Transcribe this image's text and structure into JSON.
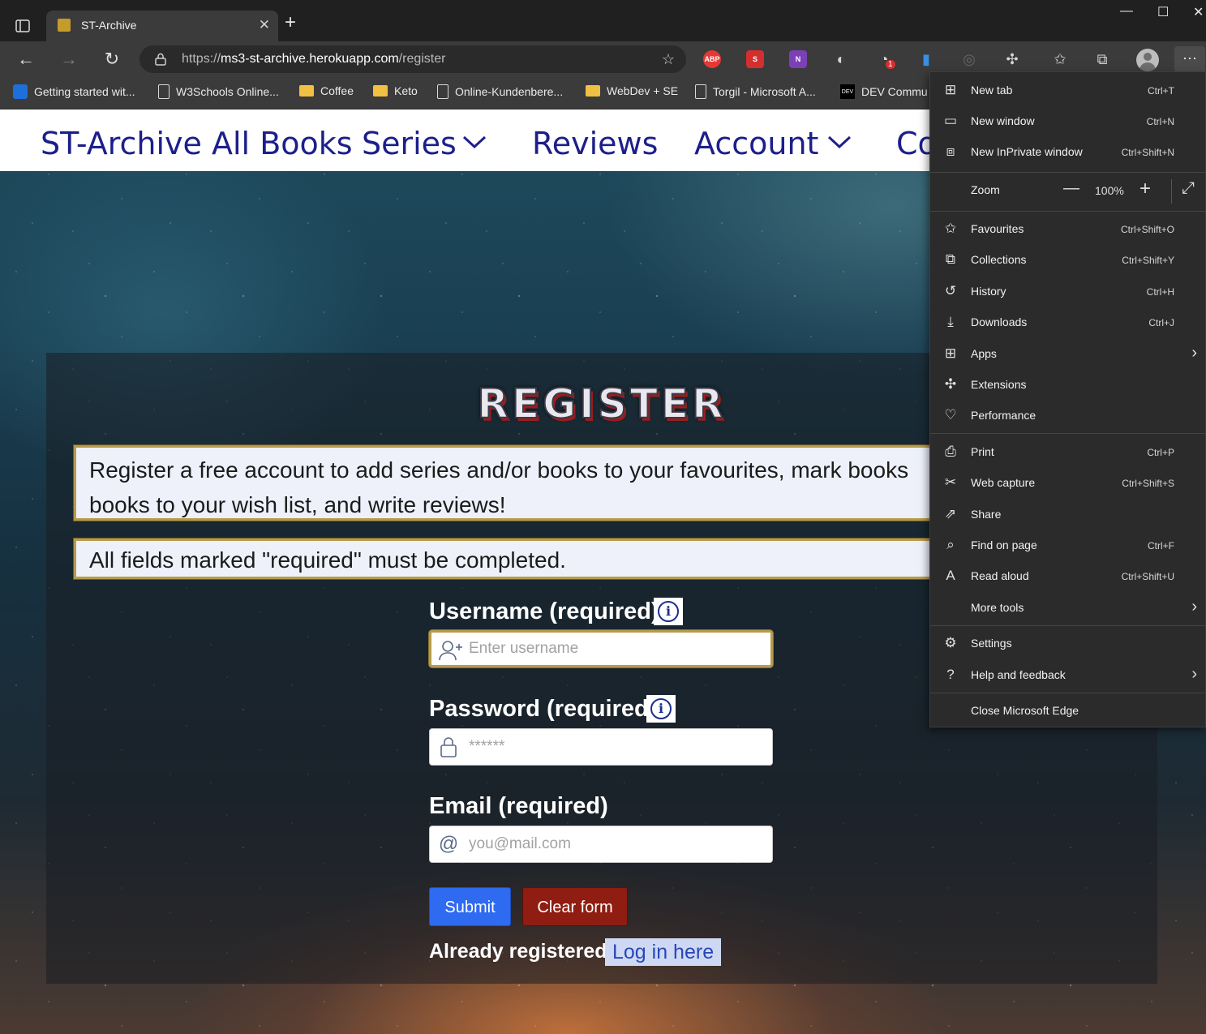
{
  "browser": {
    "tab_title": "ST-Archive",
    "url_prefix": "https://",
    "url_host": "ms3-st-archive.herokuapp.com",
    "url_path": "/register",
    "extensions": [
      "ABP",
      "S",
      "N"
    ],
    "profile_badge": "1",
    "favourites": [
      {
        "label": "Getting started wit...",
        "icon": "edge-icon"
      },
      {
        "label": "W3Schools Online...",
        "icon": "page-icon"
      },
      {
        "label": "Coffee",
        "icon": "folder-icon"
      },
      {
        "label": "Keto",
        "icon": "folder-icon"
      },
      {
        "label": "Online-Kundenbere...",
        "icon": "page-icon"
      },
      {
        "label": "WebDev + SE",
        "icon": "folder-icon"
      },
      {
        "label": "Torgil - Microsoft A...",
        "icon": "page-icon"
      },
      {
        "label": "DEV Commu",
        "icon": "dev-icon"
      }
    ]
  },
  "site": {
    "nav": {
      "brand": "ST-Archive",
      "all_books": "All Books",
      "series": "Series",
      "reviews": "Reviews",
      "account": "Account",
      "contact_partial": "Co"
    },
    "title": "REGISTER",
    "info_text": "Register a free account to add series and/or books to your favourites, mark books books to your wish list, and write reviews!",
    "info_line1": "Register a free account to add series and/or books to your favourites, mark books",
    "info_line2": "books to your wish list, and write reviews!",
    "required_note": "All fields marked \"required\" must be completed.",
    "form": {
      "username_label": "Username (required)",
      "username_placeholder": "Enter username",
      "password_label": "Password (required)",
      "password_placeholder": "******",
      "email_label": "Email (required)",
      "email_placeholder": "you@mail.com",
      "submit": "Submit",
      "clear": "Clear form",
      "already": "Already registered?",
      "login": "Log in here"
    },
    "colors": {
      "accent": "#2f6bf1",
      "danger": "#8f1d11",
      "nav_text": "#1c1f8a",
      "box_border": "#b79b4b"
    }
  },
  "menu": {
    "new_tab": {
      "label": "New tab",
      "shortcut": "Ctrl+T"
    },
    "new_window": {
      "label": "New window",
      "shortcut": "Ctrl+N"
    },
    "inprivate": {
      "label": "New InPrivate window",
      "shortcut": "Ctrl+Shift+N"
    },
    "zoom": {
      "label": "Zoom",
      "value": "100%"
    },
    "favourites": {
      "label": "Favourites",
      "shortcut": "Ctrl+Shift+O"
    },
    "collections": {
      "label": "Collections",
      "shortcut": "Ctrl+Shift+Y"
    },
    "history": {
      "label": "History",
      "shortcut": "Ctrl+H"
    },
    "downloads": {
      "label": "Downloads",
      "shortcut": "Ctrl+J"
    },
    "apps": {
      "label": "Apps"
    },
    "extensions": {
      "label": "Extensions"
    },
    "performance": {
      "label": "Performance"
    },
    "print": {
      "label": "Print",
      "shortcut": "Ctrl+P"
    },
    "web_capture": {
      "label": "Web capture",
      "shortcut": "Ctrl+Shift+S"
    },
    "share": {
      "label": "Share"
    },
    "find": {
      "label": "Find on page",
      "shortcut": "Ctrl+F"
    },
    "read_aloud": {
      "label": "Read aloud",
      "shortcut": "Ctrl+Shift+U"
    },
    "more_tools": {
      "label": "More tools"
    },
    "settings": {
      "label": "Settings"
    },
    "help": {
      "label": "Help and feedback"
    },
    "close": {
      "label": "Close Microsoft Edge"
    }
  }
}
